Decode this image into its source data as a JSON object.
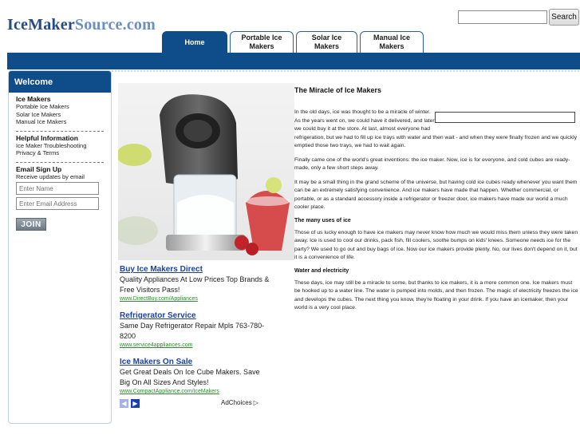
{
  "header": {
    "logo_main": "IceMaker",
    "logo_suffix": "Source.com",
    "search_placeholder": "",
    "search_button": "Search"
  },
  "tabs": [
    {
      "label": "Home",
      "active": true
    },
    {
      "label": "Portable Ice Makers",
      "active": false
    },
    {
      "label": "Solar Ice Makers",
      "active": false
    },
    {
      "label": "Manual Ice Makers",
      "active": false
    }
  ],
  "sidebar": {
    "heading": "Welcome",
    "sections": [
      {
        "title": "Ice Makers",
        "links": [
          "Portable Ice Makers",
          "Solar Ice Makers",
          "Manual Ice Makers"
        ]
      },
      {
        "title": "Helpful Information",
        "links": [
          "Ice Maker Troubleshooting",
          "Privacy & Terms"
        ]
      }
    ],
    "signup": {
      "title": "Email Sign Up",
      "text": "Receive updates by email",
      "name_placeholder": "Enter Name",
      "email_placeholder": "Enter Email Address",
      "join_label": "JOIN"
    }
  },
  "ads": [
    {
      "title": "Buy Ice Makers Direct",
      "text": "Quality Appliances At Low Prices Top Brands & Free Visitors Pass!",
      "url": "www.DirectBuy.com/Appliances"
    },
    {
      "title": "Refrigerator Service",
      "text": "Same Day Refrigerator Repair Mpls 763-780-8200",
      "url": "www.service4appliances.com"
    },
    {
      "title": "Ice Makers On Sale",
      "text": "Get Great Deals On Ice Cube Makers. Save Big On All Sizes And Styles!",
      "url": "www.CompactAppliance.com/IceMakers"
    }
  ],
  "adchoices": "AdChoices",
  "article": {
    "title": "The Miracle of Ice Makers",
    "p1": "In the old days, ice was thought to be a miracle of winter. As the years went on, we could have it delivered, and later we could buy it at the store. At last, almost everyone had refrigeration, but we had to fill up ice trays with water and then wait - and when they were finally frozen and we quickly emptied those two trays, we had to wait again.",
    "p2": "Finally came one of the world's great inventions: the ice maker. Now, ice is for everyone, and cold cubes are ready-made, only a few short steps away.",
    "p3": "It may be a small thing in the grand scheme of the universe, but having cold ice cubes ready whenever you want them can be an extremely satisfying convenience. And ice makers have made that happen. Whether commercial, or portable, or as a standard accessory inside a refrigerator or freezer door, ice makers have made our world a much cooler place.",
    "h2": "The many uses of ice",
    "p4": "Those of us lucky enough to have ice makers may never know how much we would miss them unless they were taken away. Ice is used to cool our drinks, pack fish, fill coolers, soothe bumps on kids' knees. Someone needs ice for the party? We used to go out and buy bags of ice. Now our ice makers provide plenty. No, our lives don't depend on it, but it is a convenience of life.",
    "h3": "Water and electricity",
    "p5": "These days, ice may still be a miracle to some, but thanks to ice makers, it is a more common one. Ice makers must be hooked up to a water line. The water is pumped into molds, and then frozen. The magic of electricity freezes the ice and develops the cubes. The next thing you know, they're floating in your drink. If you have an icemaker, then your world is a very cool place."
  },
  "colors": {
    "brand_blue": "#0f4c8a",
    "logo_blue": "#244a8a",
    "ad_link": "#1a3fb0",
    "ad_url": "#2c8b2c"
  }
}
